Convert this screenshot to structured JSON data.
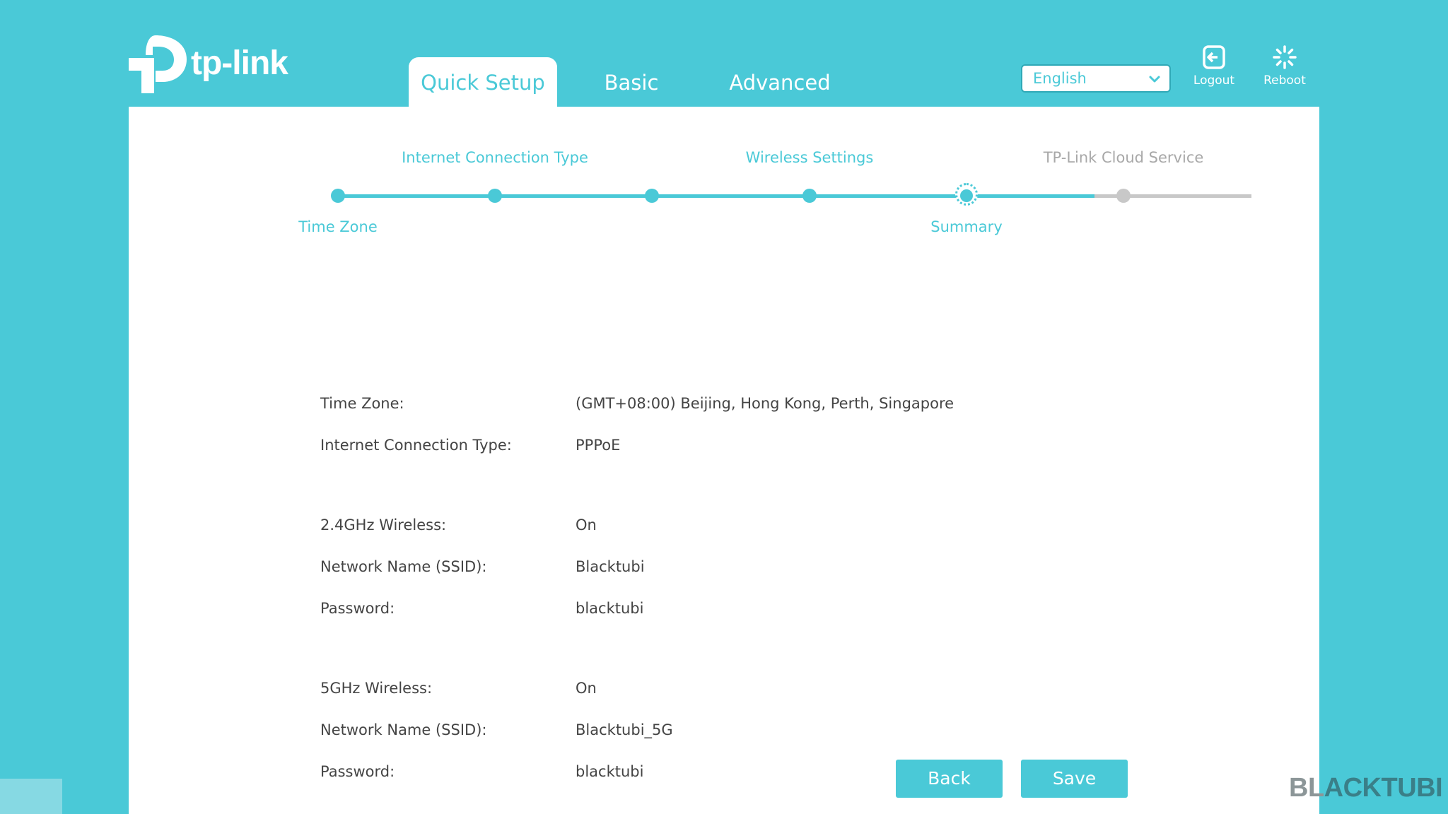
{
  "brand": {
    "name": "tp-link",
    "accent_color": "#4ac9d7"
  },
  "nav": {
    "tabs": [
      {
        "label": "Quick Setup",
        "active": true
      },
      {
        "label": "Basic",
        "active": false
      },
      {
        "label": "Advanced",
        "active": false
      }
    ]
  },
  "header": {
    "language": {
      "selected": "English",
      "icon": "chevron-down-icon"
    },
    "logout": {
      "label": "Logout",
      "icon": "logout-icon"
    },
    "reboot": {
      "label": "Reboot",
      "icon": "reboot-icon"
    }
  },
  "wizard": {
    "steps": [
      {
        "label": "Time Zone",
        "state": "done",
        "label_position": "below"
      },
      {
        "label": "Internet Connection Type",
        "state": "done",
        "label_position": "above"
      },
      {
        "label": "",
        "state": "done",
        "label_position": "none"
      },
      {
        "label": "Wireless Settings",
        "state": "done",
        "label_position": "above"
      },
      {
        "label": "Summary",
        "state": "current",
        "label_position": "below"
      },
      {
        "label": "TP-Link Cloud Service",
        "state": "pending",
        "label_position": "above"
      }
    ]
  },
  "summary": {
    "rows": [
      {
        "key": "Time Zone:",
        "value": "(GMT+08:00) Beijing, Hong Kong, Perth, Singapore"
      },
      {
        "key": "Internet Connection Type:",
        "value": "PPPoE"
      },
      {
        "key": "2.4GHz Wireless:",
        "value": "On"
      },
      {
        "key": "Network Name (SSID):",
        "value": "Blacktubi"
      },
      {
        "key": "Password:",
        "value": "blacktubi"
      },
      {
        "key": "5GHz Wireless:",
        "value": "On"
      },
      {
        "key": "Network Name (SSID):",
        "value": "Blacktubi_5G"
      },
      {
        "key": "Password:",
        "value": "blacktubi"
      }
    ]
  },
  "actions": {
    "back_label": "Back",
    "save_label": "Save"
  },
  "watermark": {
    "part1": "BL",
    "part2": "ACKTUBI"
  }
}
